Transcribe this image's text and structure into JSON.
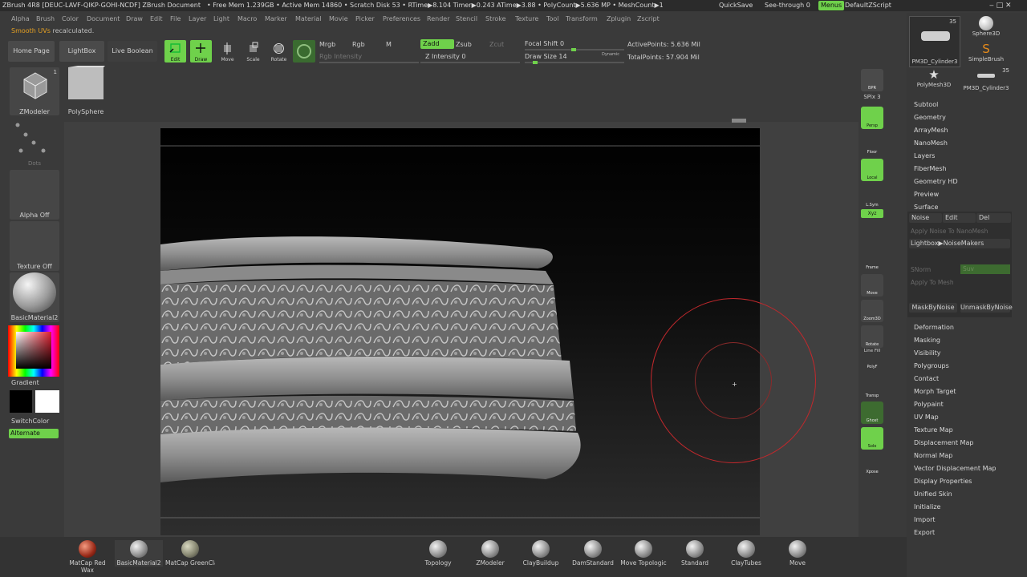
{
  "titlebar": {
    "title": "ZBrush 4R8 [DEUC-LAVF-QIKP-GOHI-NCDF]   ZBrush Document",
    "stats": "• Free Mem 1.239GB • Active Mem 14860 • Scratch Disk 53 •  RTime▶8.104 Timer▶0.243 ATime▶3.88 • PolyCount▶5.636 MP  • MeshCount▶1",
    "quicksave": "QuickSave",
    "seethrough": "See-through  0",
    "menus": "Menus",
    "defaultzscript": "DefaultZScript"
  },
  "menubar": [
    "Alpha",
    "Brush",
    "Color",
    "Document",
    "Draw",
    "Edit",
    "File",
    "Layer",
    "Light",
    "Macro",
    "Marker",
    "Material",
    "Movie",
    "Picker",
    "Preferences",
    "Render",
    "Stencil",
    "Stroke",
    "Texture",
    "Tool",
    "Transform",
    "Zplugin",
    "Zscript"
  ],
  "status": {
    "prefix": "Smooth UVs",
    "suffix": " recalculated."
  },
  "top_shelf": {
    "home_page": "Home Page",
    "lightbox": "LightBox",
    "live_boolean": "Live Boolean",
    "edit": "Edit",
    "draw": "Draw",
    "move": "Move",
    "scale": "Scale",
    "rotate": "Rotate",
    "mrgb": "Mrgb",
    "rgb": "Rgb",
    "m": "M",
    "rgb_intensity": "Rgb Intensity",
    "zadd": "Zadd",
    "zsub": "Zsub",
    "zcut": "Zcut",
    "z_intensity": "Z Intensity 0",
    "focal_shift": "Focal Shift 0",
    "draw_size": "Draw Size 14",
    "dynamic": "Dynamic",
    "active_points": "ActivePoints: 5.636 Mil",
    "total_points": "TotalPoints: 57.904 Mil"
  },
  "left_shelf": {
    "brush_name": "ZModeler",
    "brush_count": "1",
    "polysphere": "PolySphere",
    "stroke": "Dots",
    "alpha": "Alpha Off",
    "texture": "Texture Off",
    "material": "BasicMaterial2",
    "gradient": "Gradient",
    "switchcolor": "SwitchColor",
    "alternate": "Alternate"
  },
  "tool_palette": {
    "thumbs": [
      {
        "label": "PM3D_Cylinder3",
        "count": "35"
      },
      {
        "label": "Sphere3D",
        "count": ""
      },
      {
        "label": "SimpleBrush",
        "count": ""
      },
      {
        "label": "PolyMesh3D",
        "count": ""
      },
      {
        "label": "PM3D_Cylinder3",
        "count": "35"
      }
    ],
    "items": [
      "Subtool",
      "Geometry",
      "ArrayMesh",
      "NanoMesh",
      "Layers",
      "FiberMesh",
      "Geometry HD",
      "Preview",
      "Surface"
    ],
    "surface": {
      "noise": "Noise",
      "edit": "Edit",
      "del": "Del",
      "apply_nanomesh": "Apply Noise To NanoMesh",
      "lightbox_noisemakers": "Lightbox▶NoiseMakers",
      "snorm": "SNorm",
      "suv": "Suv",
      "apply_mesh": "Apply To Mesh",
      "maskbynoise": "MaskByNoise",
      "unmaskbynoise": "UnmaskByNoise"
    },
    "items2": [
      "Deformation",
      "Masking",
      "Visibility",
      "Polygroups",
      "Contact",
      "Morph Target",
      "Polypaint",
      "UV Map",
      "Texture Map",
      "Displacement Map",
      "Normal Map",
      "Vector Displacement Map",
      "Display Properties",
      "Unified Skin",
      "Initialize",
      "Import",
      "Export"
    ]
  },
  "right_shelf": {
    "bpr": "BPR",
    "spix": "SPix 3",
    "persp": "Persp",
    "floor": "Floor",
    "local": "Local",
    "lsym": "L.Sym",
    "xyz": "Xyz",
    "frame": "Frame",
    "move": "Move",
    "zoom3d": "Zoom3D",
    "rotate": "Rotate",
    "linefill": "Line Fill",
    "polyf": "PolyF",
    "transp": "Transp",
    "ghost": "Ghost",
    "solo": "Solo",
    "xpose": "Xpose"
  },
  "bottom_materials": [
    "MatCap Red Wax",
    "BasicMaterial2",
    "MatCap GreenClay"
  ],
  "bottom_brushes": [
    "Topology",
    "ZModeler",
    "ClayBuildup",
    "DamStandard",
    "Move Topologic",
    "Standard",
    "ClayTubes",
    "Move"
  ],
  "colors": {
    "accent_green": "#6fd14b",
    "status_orange": "#e5a023",
    "brush_ring": "#c0282c"
  }
}
